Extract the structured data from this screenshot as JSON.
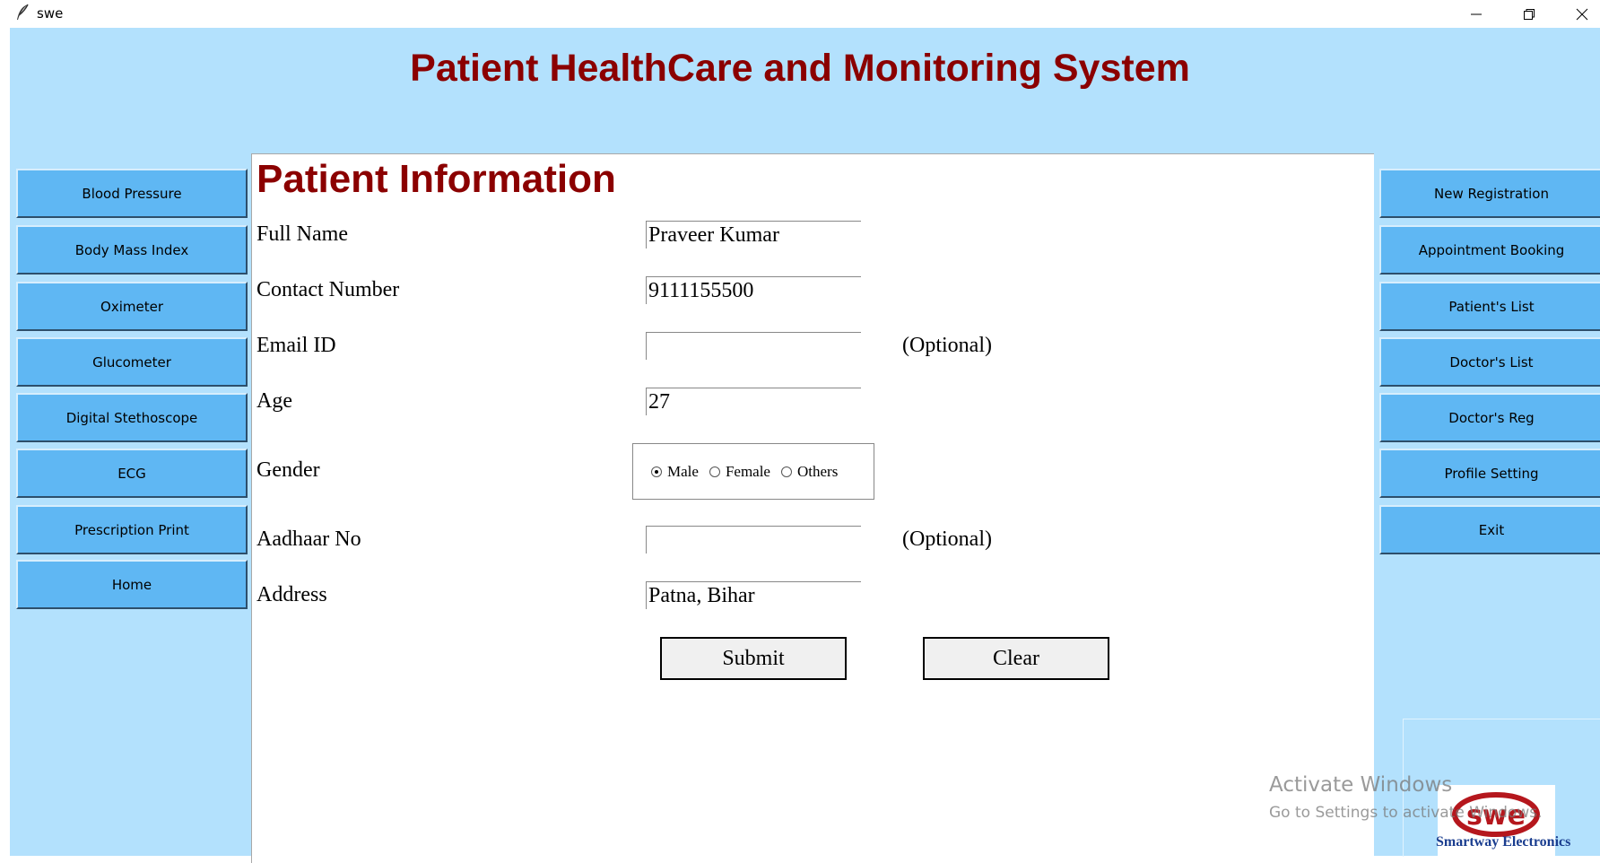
{
  "window": {
    "title": "swe",
    "icon": "feather-icon",
    "controls": [
      "minimize-icon",
      "restore-icon",
      "close-icon"
    ]
  },
  "app": {
    "title": "Patient HealthCare and Monitoring System",
    "colors": {
      "background": "#b3e1fd",
      "button": "#5fb7f3",
      "heading": "#8b0000"
    }
  },
  "left_menu": {
    "items": [
      {
        "label": "Blood Pressure"
      },
      {
        "label": "Body Mass Index"
      },
      {
        "label": "Oximeter"
      },
      {
        "label": "Glucometer"
      },
      {
        "label": "Digital Stethoscope"
      },
      {
        "label": "ECG"
      },
      {
        "label": "Prescription Print"
      },
      {
        "label": "Home"
      }
    ]
  },
  "right_menu": {
    "items": [
      {
        "label": "New Registration"
      },
      {
        "label": "Appointment Booking"
      },
      {
        "label": "Patient's List"
      },
      {
        "label": "Doctor's List"
      },
      {
        "label": "Doctor's Reg"
      },
      {
        "label": "Profile Setting"
      },
      {
        "label": "Exit"
      }
    ]
  },
  "form": {
    "title": "Patient Information",
    "full_name": {
      "label": "Full Name",
      "value": "Praveer Kumar"
    },
    "contact": {
      "label": "Contact Number",
      "value": "9111155500"
    },
    "email": {
      "label": "Email ID",
      "value": "",
      "note": "(Optional)"
    },
    "age": {
      "label": "Age",
      "value": "27"
    },
    "gender": {
      "label": "Gender",
      "options": [
        "Male",
        "Female",
        "Others"
      ],
      "selected": "Male"
    },
    "aadhaar": {
      "label": "Aadhaar No",
      "value": "",
      "note": "(Optional)"
    },
    "address": {
      "label": "Address",
      "value": "Patna, Bihar"
    },
    "submit_label": "Submit",
    "clear_label": "Clear"
  },
  "logo": {
    "text": "Smartway Electronics"
  },
  "watermark": {
    "line1": "Activate Windows",
    "line2": "Go to Settings to activate Windows."
  }
}
